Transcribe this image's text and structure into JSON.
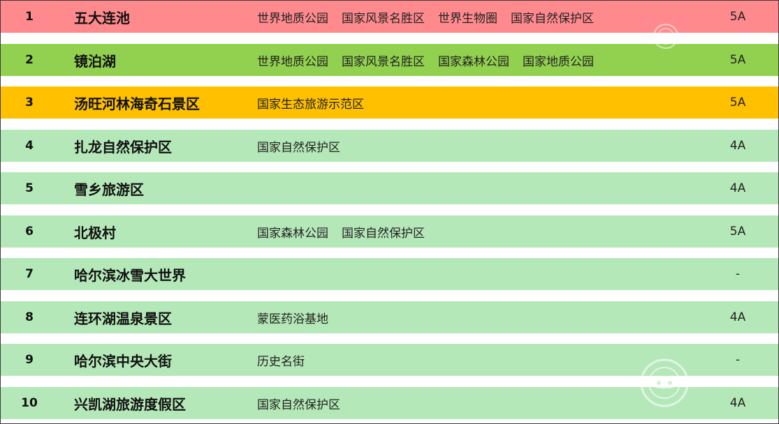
{
  "colors": {
    "row_1": "#ff8a8d",
    "row_2": "#92d14f",
    "row_3": "#ffc000",
    "row_default": "#b5e8b8",
    "separator": "#ffffff",
    "border": "#3a3a3a"
  },
  "rows": [
    {
      "rank": "1",
      "name": "五大连池",
      "tags": [
        "世界地质公园",
        "国家风景名胜区",
        "世界生物圈",
        "国家自然保护区"
      ],
      "grade": "5A"
    },
    {
      "rank": "2",
      "name": "镜泊湖",
      "tags": [
        "世界地质公园",
        "国家风景名胜区",
        "国家森林公园",
        "国家地质公园"
      ],
      "grade": "5A"
    },
    {
      "rank": "3",
      "name": "汤旺河林海奇石景区",
      "tags": [
        "国家生态旅游示范区"
      ],
      "grade": "5A"
    },
    {
      "rank": "4",
      "name": "扎龙自然保护区",
      "tags": [
        "国家自然保护区"
      ],
      "grade": "4A"
    },
    {
      "rank": "5",
      "name": "雪乡旅游区",
      "tags": [],
      "grade": "4A"
    },
    {
      "rank": "6",
      "name": "北极村",
      "tags": [
        "国家森林公园",
        "国家自然保护区"
      ],
      "grade": "5A"
    },
    {
      "rank": "7",
      "name": "哈尔滨冰雪大世界",
      "tags": [],
      "grade": "-"
    },
    {
      "rank": "8",
      "name": "连环湖温泉景区",
      "tags": [
        "蒙医药浴基地"
      ],
      "grade": "4A"
    },
    {
      "rank": "9",
      "name": "哈尔滨中央大街",
      "tags": [
        "历史名街"
      ],
      "grade": "-"
    },
    {
      "rank": "10",
      "name": "兴凯湖旅游度假区",
      "tags": [
        "国家自然保护区"
      ],
      "grade": "4A"
    }
  ],
  "watermarks": [
    {
      "name": "seal-watermark-top",
      "icon": "seal-icon"
    },
    {
      "name": "seal-watermark-bottom",
      "icon": "seal-icon"
    }
  ]
}
